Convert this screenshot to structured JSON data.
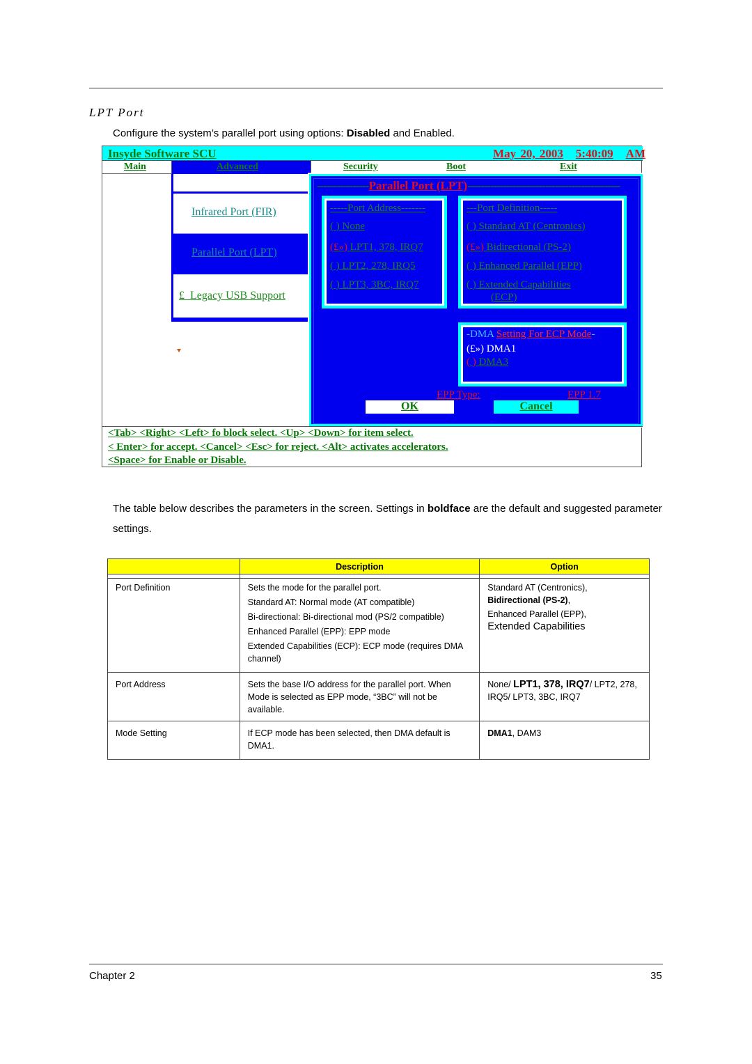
{
  "section_title": "LPT Port",
  "intro": {
    "before": "Configure the system’s parallel port using options: ",
    "bold": "Disabled",
    "after": " and Enabled."
  },
  "bios": {
    "app_title": "Insyde Software SCU",
    "date": "May 20, 2003",
    "time": "5:40:09",
    "ampm": "AM",
    "menu": [
      "Main",
      "Advanced",
      "Security",
      "Boot",
      "Exit"
    ],
    "submenu": {
      "items": [
        "Infrared Port (FIR)",
        "Parallel Port (LPT)",
        "Legacy USB Support"
      ],
      "usb_prefix": "£"
    },
    "dialog": {
      "title": "Parallel Port (LPT)",
      "port_address": {
        "header": "-----Port Address-------",
        "options": [
          {
            "mark": "(    )",
            "label": " None"
          },
          {
            "mark": "(£»)",
            "label": " LPT1, 378, IRQ7"
          },
          {
            "mark": "(    )",
            "label": " LPT2, 278, IRQ5"
          },
          {
            "mark": "(    )",
            "label": " LPT3, 3BC, IRQ7"
          }
        ],
        "selected_index": 1
      },
      "port_definition": {
        "header": "---Port Definition-----",
        "options": [
          {
            "mark": "(    )",
            "label": " Standard AT (Centronics)"
          },
          {
            "mark": "(£»)",
            "label": " Bidirectional (PS-2)"
          },
          {
            "mark": "(    )",
            "label": " Enhanced Parallel (EPP)"
          },
          {
            "mark": "(    )",
            "label": " Extended Capabilities"
          }
        ],
        "ecp_continuation": "(ECP)",
        "selected_index": 1
      },
      "dma": {
        "header_prefix": "-DMA ",
        "header_rest": "Setting For ECP Mode",
        "header_suffix": "-",
        "options": [
          {
            "mark": "(£»)",
            "label": " DMA1"
          },
          {
            "mark": "(    )",
            "label": " DMA3"
          }
        ],
        "selected_index": 0
      },
      "epp_type_label": "EPP Type:",
      "epp_type_value": "EPP 1.7",
      "ok_label": "OK",
      "cancel_label": "Cancel"
    },
    "help": [
      "<Tab> <Right> <Left> fo block select.     <Up> <Down> for item select.",
      "< Enter> for accept. <Cancel> <Esc> for reject. <Alt> activates accelerators.",
      "<Space> for Enable or Disable."
    ]
  },
  "paragraph": {
    "before": "The table below describes the parameters in the screen. Settings in ",
    "bold": "boldface",
    "after": " are the default and suggested parameter settings."
  },
  "table": {
    "headers": [
      "",
      "Description",
      "Option"
    ],
    "rows": [
      {
        "parameter": "Port Definition",
        "description": [
          "Sets the mode for the parallel port.",
          "Standard AT: Normal mode (AT compatible)",
          "Bi-directional: Bi-directional mod (PS/2 compatible)",
          "Enhanced Parallel (EPP): EPP mode",
          "Extended Capabilities (ECP): ECP mode (requires DMA channel)"
        ],
        "options": [
          {
            "text": "Standard AT (Centronics),",
            "bold": false
          },
          {
            "text": "Bidirectional (PS-2)",
            "bold": true,
            "suffix": ","
          },
          {
            "text": "Enhanced Parallel (EPP),",
            "bold": false
          },
          {
            "text": "Extended Capabilities",
            "bold": false,
            "large": true
          }
        ]
      },
      {
        "parameter": "Port Address",
        "description": [
          "Sets the base I/O address for the parallel port. When Mode is selected as EPP mode, “3BC” will not be available."
        ],
        "options_text": {
          "pre": "None/ ",
          "bold": "LPT1, 378, IRQ7",
          "post": "/ LPT2, 278, IRQ5/ LPT3, 3BC, IRQ7"
        }
      },
      {
        "parameter": "Mode Setting",
        "description": [
          "If ECP mode has been selected, then DMA default is DMA1."
        ],
        "options_text": {
          "bold": "DMA1",
          "post": ", DAM3"
        }
      }
    ]
  },
  "footer": {
    "chapter": "Chapter 2",
    "page": "35"
  }
}
